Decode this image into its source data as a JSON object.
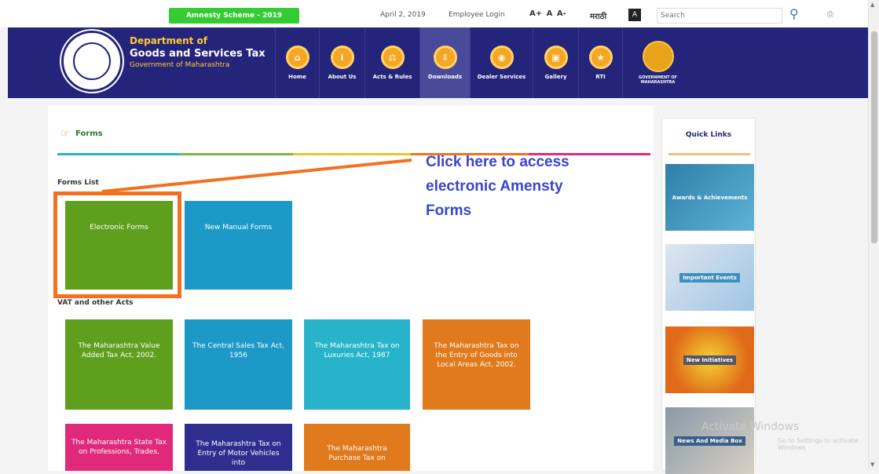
{
  "topbar": {
    "amnesty_label": "Amnesty Scheme - 2019",
    "date": "April 2, 2019",
    "employee_login": "Employee Login",
    "font_sizes": "A+ A A-",
    "marathi": "मराठी",
    "contrast": "A",
    "search_placeholder": "Search"
  },
  "header": {
    "line1": "Department of",
    "line2": "Goods and Services Tax",
    "line3": "Government of Maharashtra",
    "nav": [
      "Home",
      "About Us",
      "Acts & Rules",
      "Downloads",
      "Dealer Services",
      "Gallery",
      "RTI"
    ],
    "emblem_label": "GOVERNMENT OF MAHARASHTRA"
  },
  "main": {
    "title": "Forms",
    "forms_list_label": "Forms List",
    "tiles_forms": [
      "Electronic Forms",
      "New Manual Forms"
    ],
    "vat_label": "VAT and other Acts",
    "tiles_acts_row1": [
      "The Maharashtra Value Added Tax Act, 2002.",
      "The Central Sales Tax Act, 1956",
      "The Maharashtra Tax on Luxuries Act, 1987",
      "The Maharashtra Tax on the Entry of Goods into Local Areas Act, 2002."
    ],
    "tiles_acts_row2": [
      "The Maharashtra State Tax on Professions, Trades,",
      "The Maharashtra Tax on Entry of Motor Vehicles into",
      "The Maharashtra Purchase Tax on"
    ]
  },
  "callout": {
    "line1": "Click here to access",
    "line2": "electronic Amensty",
    "line3": "Forms"
  },
  "quick_links": {
    "title": "Quick Links",
    "cards": [
      "Awards & Achievements",
      "Important Events",
      "New Initiatives",
      "News And Media Box"
    ]
  },
  "watermark": {
    "line1": "Activate Windows",
    "line2": "Go to Settings to activate Windows"
  },
  "colors": {
    "header_bg": "#24247a",
    "green_tile": "#5e9f1e",
    "blue_tile": "#1d99c8",
    "teal_tile": "#27b3c9",
    "orange_tile": "#e07a1c",
    "pink_tile": "#e0297a",
    "navy_tile": "#2e2e8e",
    "highlight": "#f37021",
    "callout_text": "#3a45c8"
  }
}
